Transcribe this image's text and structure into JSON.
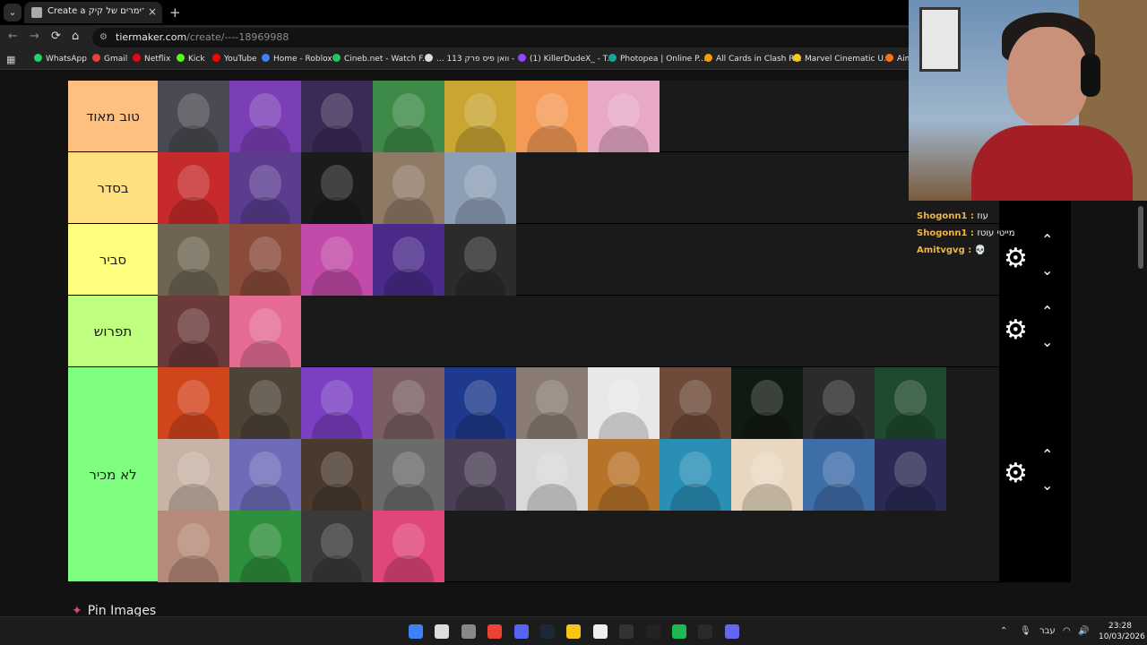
{
  "browser": {
    "tab_title": "Create a רוג סטרימרים של קיק Tier List",
    "tab_close": "×",
    "new_tab": "+",
    "url_host": "tiermaker.com",
    "url_path": "/create/----18969988",
    "bookmarks": [
      {
        "label": "WhatsApp",
        "color": "#25d366"
      },
      {
        "label": "Gmail",
        "color": "#ea4335"
      },
      {
        "label": "Netflix",
        "color": "#e50914"
      },
      {
        "label": "Kick",
        "color": "#53fc18"
      },
      {
        "label": "YouTube",
        "color": "#ff0000"
      },
      {
        "label": "Home - Roblox",
        "color": "#3b82f6"
      },
      {
        "label": "Cineb.net - Watch F...",
        "color": "#22c55e"
      },
      {
        "label": "... וואן פיס פרק 113 -",
        "color": "#dddddd"
      },
      {
        "label": "(1) KillerDudeX_ - T...",
        "color": "#9146ff"
      },
      {
        "label": "Photopea | Online P...",
        "color": "#18a497"
      },
      {
        "label": "All Cards in Clash R...",
        "color": "#f59e0b"
      },
      {
        "label": "Marvel Cinematic U...",
        "color": "#facc15"
      },
      {
        "label": "Aim",
        "color": "#f97316"
      }
    ]
  },
  "tiers": [
    {
      "label": "טוב מאוד",
      "color": "#ffbf7f",
      "items": [
        "#4a4a52",
        "#7b3fb5",
        "#3b2a55",
        "#3e8a48",
        "#c9a532",
        "#f59a55",
        "#e8a8c8"
      ]
    },
    {
      "label": "בסדר",
      "color": "#ffdf7f",
      "items": [
        "#c62a2a",
        "#5b3c8f",
        "#1b1b1b",
        "#8f7a66",
        "#8c9fb5"
      ]
    },
    {
      "label": "סביר",
      "color": "#ffff7f",
      "items": [
        "#6e6452",
        "#8a4b3b",
        "#c24aa8",
        "#4a2a88",
        "#2b2b2b"
      ]
    },
    {
      "label": "תפרוש",
      "color": "#bfff7f",
      "items": [
        "#6b3a3a",
        "#e56b93"
      ]
    },
    {
      "label": "לא מכיר",
      "color": "#7fff7f",
      "items": [
        "#d1451c",
        "#4e4336",
        "#7b3fc1",
        "#7a5e63",
        "#1f3a8c",
        "#8a7c72",
        "#e8e8e8",
        "#6e4a3a",
        "#101a12",
        "#2b2b2b",
        "#1f4a2e",
        "#c8b4a6",
        "#6f6bb8",
        "#4a3a2e",
        "#6b6b6b",
        "#4a3f54",
        "#d9d9d9",
        "#b8732a",
        "#2a8fb5",
        "#e8d8c2",
        "#3e6ea8",
        "#2a2a55",
        "#b58a7a",
        "#2e8f3c",
        "#3a3a3a",
        "#e0457b"
      ]
    }
  ],
  "controls": {
    "gear_icon": "⚙",
    "up_icon": "⌃",
    "down_icon": "⌄"
  },
  "pin_images": "Pin Images",
  "chat": [
    {
      "user": "Shogonn1",
      "message": "עוז"
    },
    {
      "user": "Shogonn1",
      "message": "מייטי עוטז"
    },
    {
      "user": "Amitvgvg",
      "message": "💀"
    }
  ],
  "taskbar": {
    "language": "עבר",
    "time": "23:28",
    "date": "10/03/2026",
    "icons": [
      "#3b82f6",
      "#dddddd",
      "#888888",
      "#ea4335",
      "#5865f2",
      "#1b2838",
      "#f5c518",
      "#eeeeee",
      "#333333",
      "#222222",
      "#1db954",
      "#2a2a2a",
      "#6366f1"
    ]
  }
}
